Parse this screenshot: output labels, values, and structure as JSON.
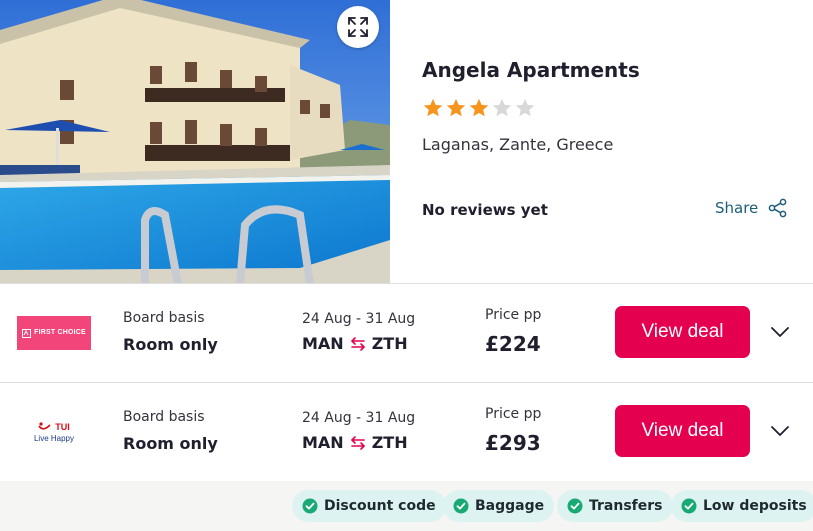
{
  "hotel": {
    "name": "Angela Apartments",
    "rating": 3,
    "rating_max": 5,
    "location": "Laganas, Zante, Greece",
    "reviews": "No reviews yet",
    "share_label": "Share"
  },
  "deals": [
    {
      "operator_logo": "FIRST CHOICE",
      "board_label": "Board basis",
      "board_value": "Room only",
      "dates": "24 Aug - 31 Aug",
      "from": "MAN",
      "to": "ZTH",
      "price_label": "Price pp",
      "price": "£224",
      "button_label": "View deal"
    },
    {
      "operator_logo": "TUI",
      "operator_tagline": "Live Happy",
      "board_label": "Board basis",
      "board_value": "Room only",
      "dates": "24 Aug - 31 Aug",
      "from": "MAN",
      "to": "ZTH",
      "price_label": "Price pp",
      "price": "£293",
      "button_label": "View deal"
    }
  ],
  "features": [
    "Discount code",
    "Baggage",
    "Transfers",
    "Low deposits"
  ],
  "colors": {
    "accent": "#e5004f",
    "star": "#f7941d",
    "star_empty": "#d8d8d8",
    "link": "#1d5e7a",
    "check": "#19a974",
    "pill": "#ddf3f1"
  }
}
